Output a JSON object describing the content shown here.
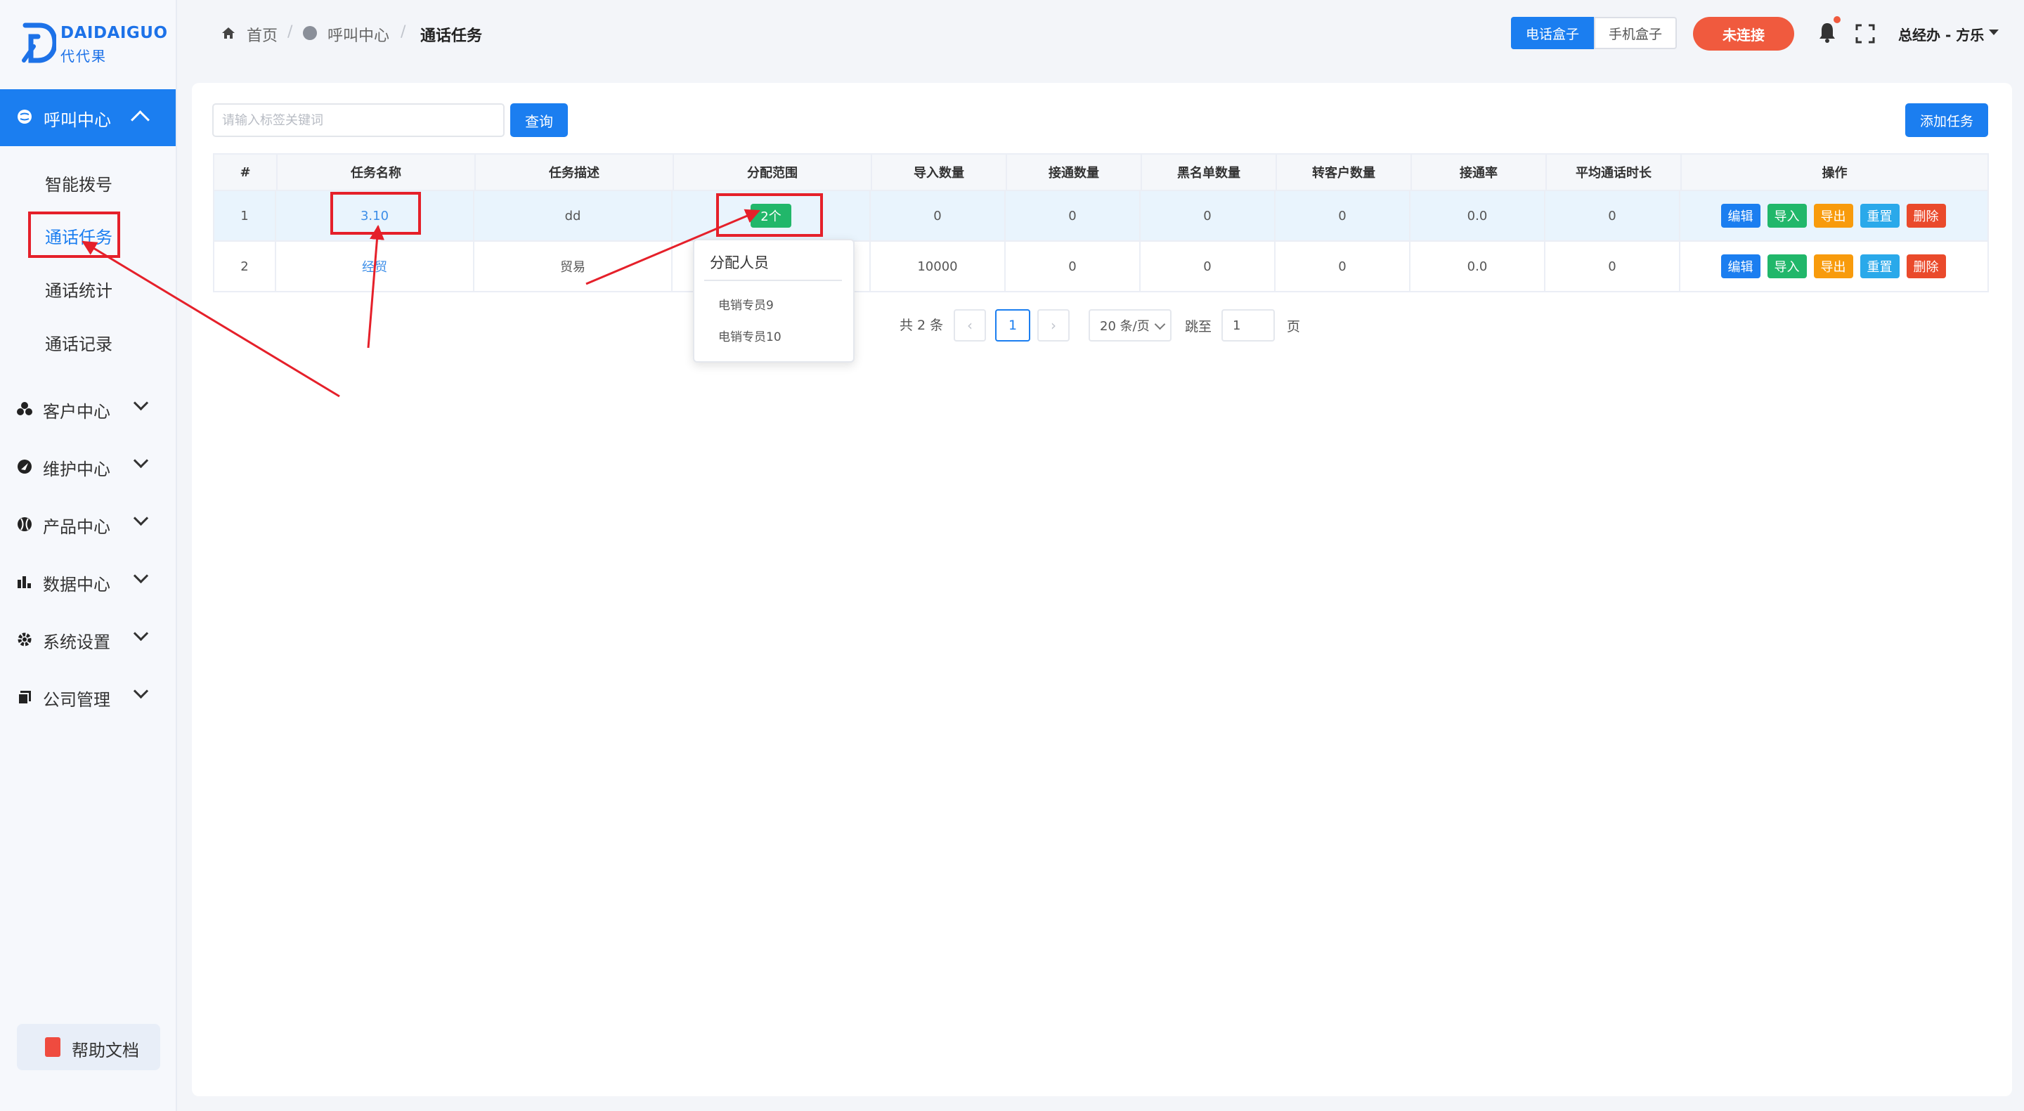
{
  "logo": {
    "en": "DAIDAIGUO",
    "cn": "代代果"
  },
  "sidebar": {
    "active_group": {
      "label": "呼叫中心",
      "icon": "call-center-icon"
    },
    "sub_items": [
      {
        "label": "智能拨号",
        "active": false
      },
      {
        "label": "通话任务",
        "active": true
      },
      {
        "label": "通话统计",
        "active": false
      },
      {
        "label": "通话记录",
        "active": false
      }
    ],
    "groups": [
      {
        "label": "客户中心",
        "icon": "customer-icon"
      },
      {
        "label": "维护中心",
        "icon": "maintenance-icon"
      },
      {
        "label": "产品中心",
        "icon": "product-icon"
      },
      {
        "label": "数据中心",
        "icon": "data-icon"
      },
      {
        "label": "系统设置",
        "icon": "gear-icon"
      },
      {
        "label": "公司管理",
        "icon": "company-icon"
      }
    ],
    "help": {
      "label": "帮助文档",
      "icon": "help-doc-icon"
    }
  },
  "header": {
    "breadcrumb": {
      "home": "首页",
      "section": "呼叫中心",
      "current": "通话任务"
    },
    "toggle": {
      "on": "电话盒子",
      "off": "手机盒子"
    },
    "connection": "未连接",
    "user": "总经办 - 方乐"
  },
  "toolbar": {
    "search_placeholder": "请输入标签关键词",
    "query_label": "查询",
    "add_label": "添加任务"
  },
  "table": {
    "columns": [
      "#",
      "任务名称",
      "任务描述",
      "分配范围",
      "导入数量",
      "接通数量",
      "黑名单数量",
      "转客户数量",
      "接通率",
      "平均通话时长",
      "操作"
    ],
    "rows": [
      {
        "index": "1",
        "name": "3.10",
        "desc": "dd",
        "scope": "2个",
        "imported": "0",
        "connected": "0",
        "blacklist": "0",
        "converted": "0",
        "rate": "0.0",
        "avg_duration": "0"
      },
      {
        "index": "2",
        "name": "经贸",
        "desc": "贸易",
        "scope": "",
        "imported": "10000",
        "connected": "0",
        "blacklist": "0",
        "converted": "0",
        "rate": "0.0",
        "avg_duration": "0"
      }
    ],
    "actions": {
      "edit": "编辑",
      "import": "导入",
      "export": "导出",
      "reset": "重置",
      "delete": "删除"
    }
  },
  "popover": {
    "title": "分配人员",
    "items": [
      "电销专员9",
      "电销专员10"
    ]
  },
  "pagination": {
    "total": "共 2 条",
    "prev": "‹",
    "next": "›",
    "current_page": "1",
    "page_size": "20 条/页",
    "goto_label": "跳至",
    "goto_value": "1",
    "page_suffix": "页"
  },
  "colors": {
    "primary": "#1b7ef0",
    "success": "#21b76a",
    "warning": "#f89b0c",
    "info": "#2aa9ea",
    "danger": "#ea4a2b",
    "annotation": "#e5202a"
  }
}
